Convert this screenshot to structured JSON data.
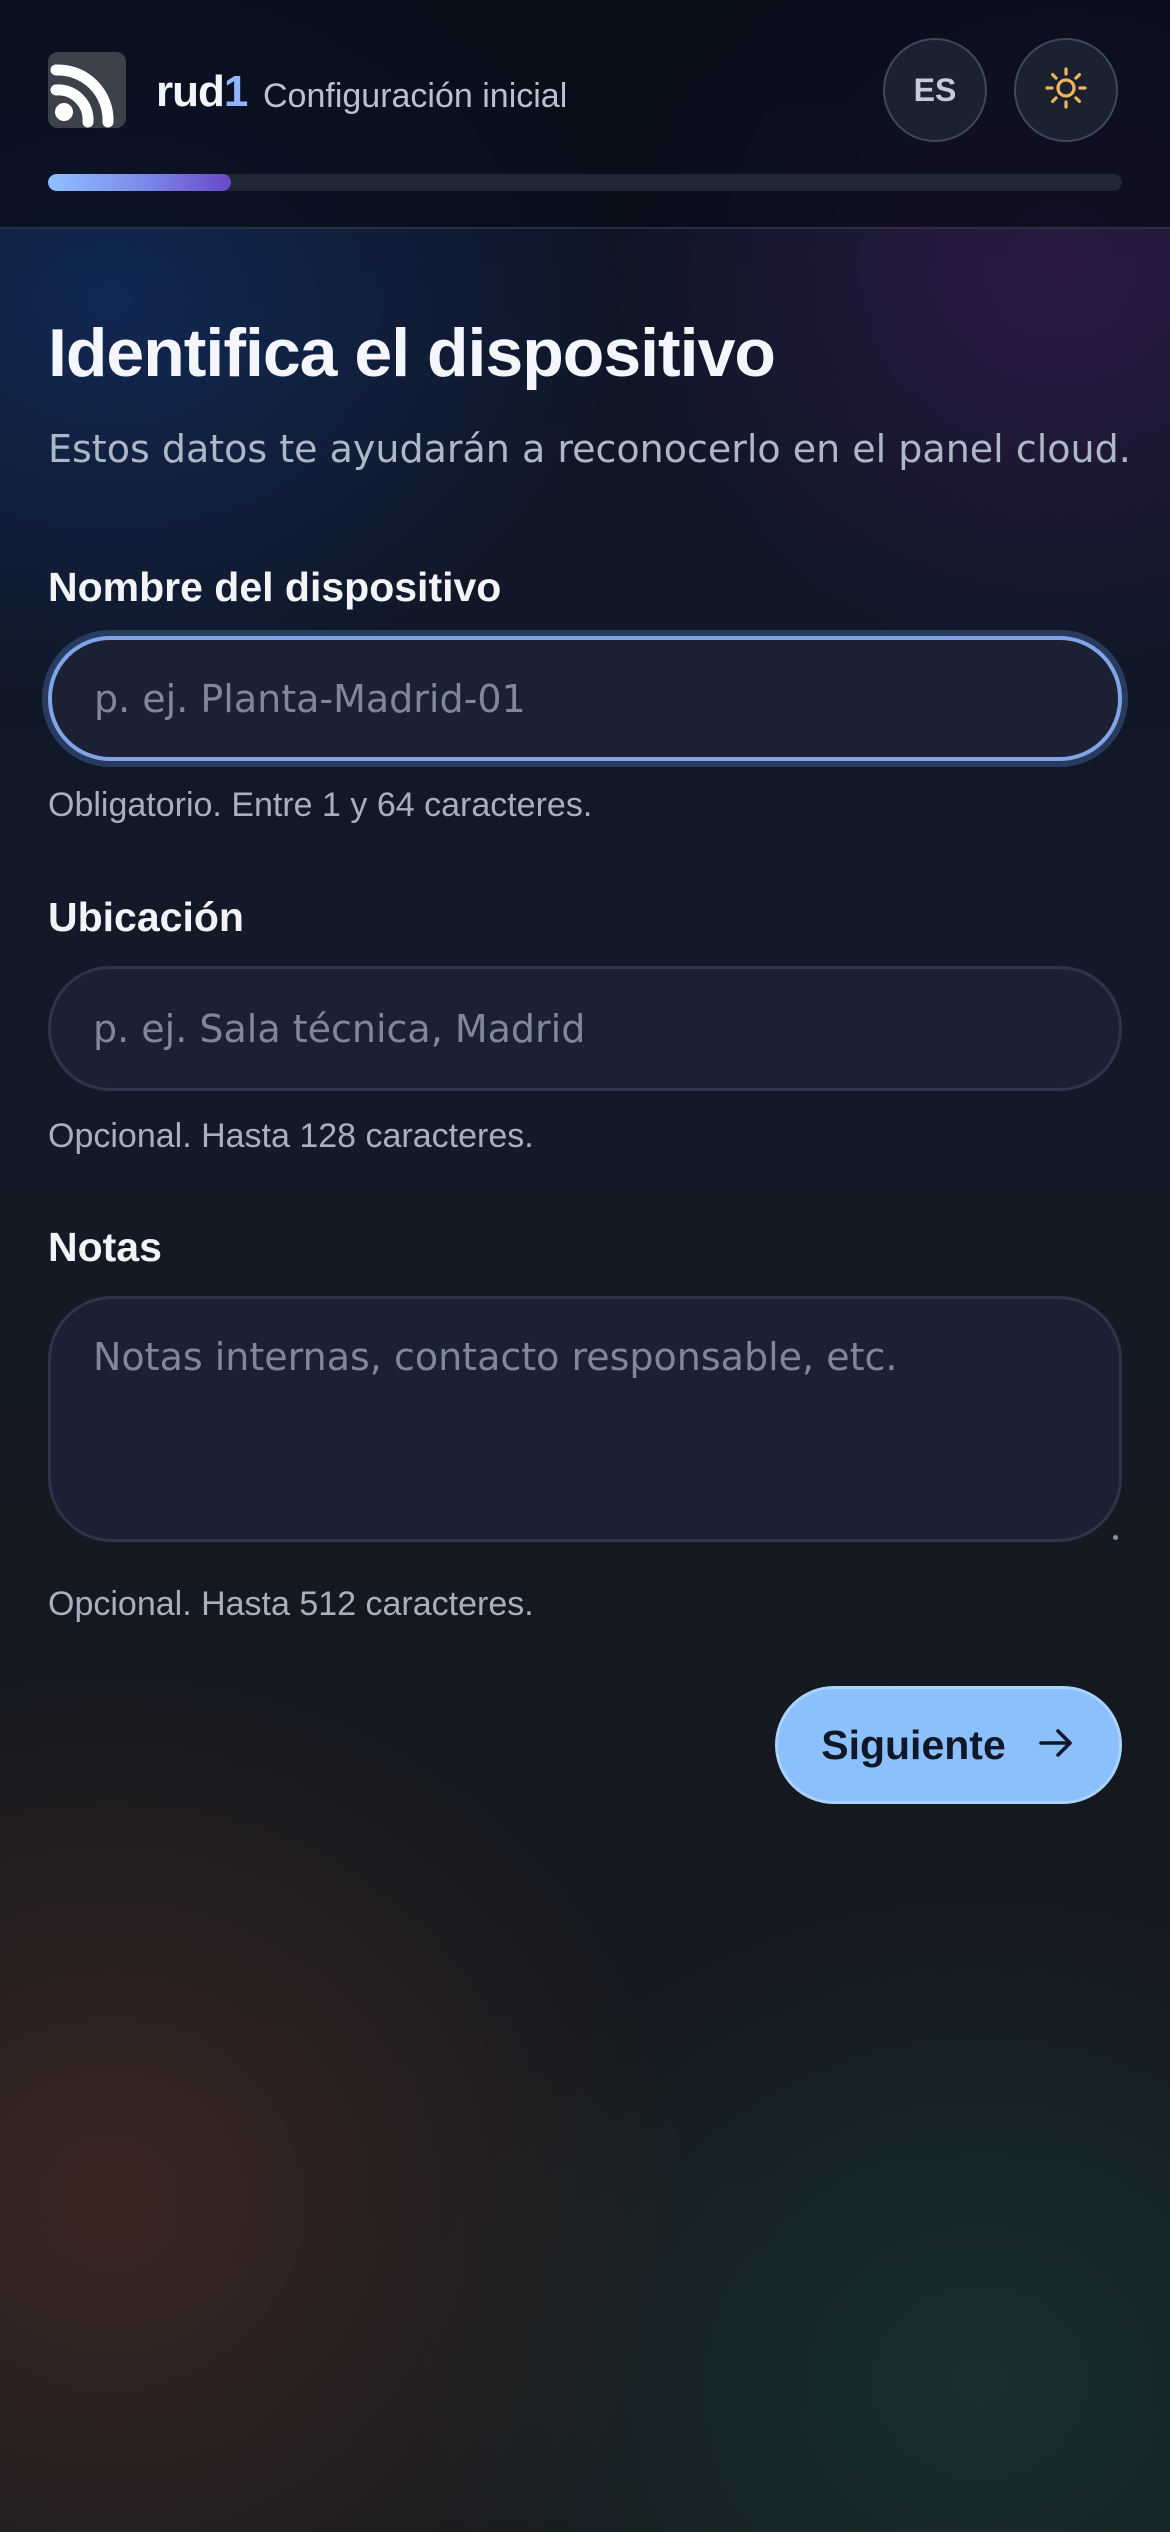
{
  "header": {
    "brand_name": "rud",
    "brand_accent": "1",
    "subtitle": "Configuración inicial",
    "language_label": "ES",
    "theme_icon": "sun-icon",
    "logo_icon": "rss-feed-icon",
    "progress": 0.17
  },
  "page": {
    "title": "Identifica el dispositivo",
    "description": "Estos datos te ayudarán a reconocerlo en el panel cloud."
  },
  "fields": {
    "name": {
      "label": "Nombre del dispositivo",
      "value": "",
      "placeholder": "p. ej. Planta-Madrid-01",
      "hint": "Obligatorio. Entre 1 y 64 caracteres."
    },
    "location": {
      "label": "Ubicación",
      "value": "",
      "placeholder": "p. ej. Sala técnica, Madrid",
      "hint": "Opcional. Hasta 128 caracteres."
    },
    "notes": {
      "label": "Notas",
      "value": "",
      "placeholder": "Notas internas, contacto responsable, etc.",
      "hint": "Opcional. Hasta 512 caracteres."
    }
  },
  "actions": {
    "next_label": "Siguiente",
    "next_icon": "arrow-right-icon"
  },
  "colors": {
    "accent": "#8cc0fc",
    "brand_accent": "#8fb6ff",
    "focus_ring": "#7fa5e6",
    "theme_icon": "#f2b35b"
  }
}
